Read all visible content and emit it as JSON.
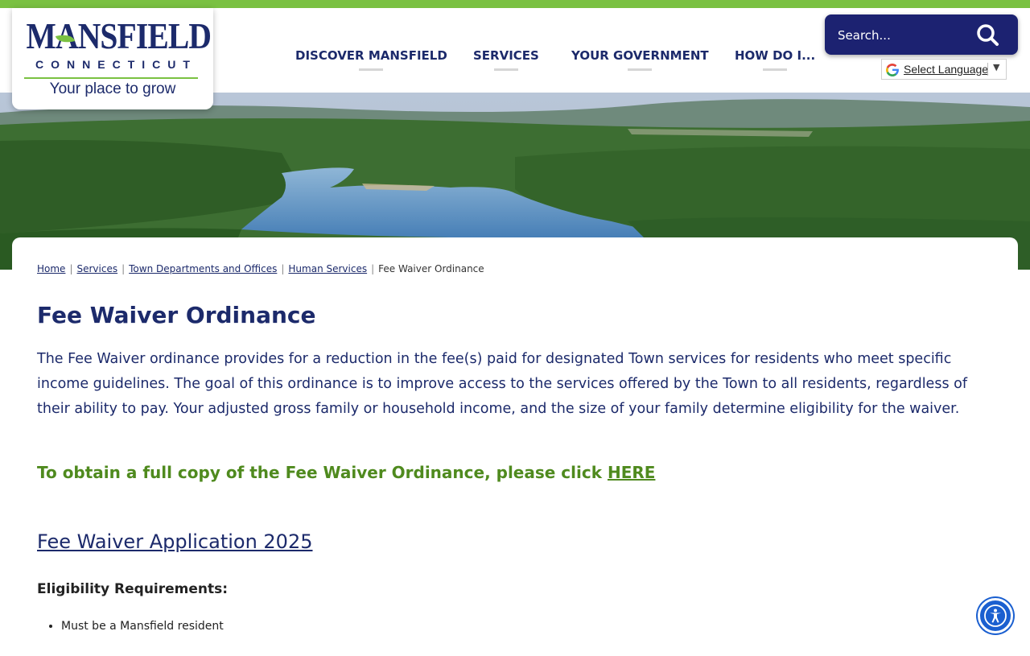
{
  "site": {
    "logo": {
      "name": "MANSFIELD",
      "sub": "CONNECTICUT",
      "tagline": "Your place to grow"
    }
  },
  "nav": {
    "items": [
      {
        "label": "DISCOVER MANSFIELD"
      },
      {
        "label": "SERVICES"
      },
      {
        "label": "YOUR GOVERNMENT"
      },
      {
        "label": "HOW DO I..."
      }
    ]
  },
  "search": {
    "placeholder": "Search..."
  },
  "language": {
    "label": "Select Language",
    "arrow": "▼"
  },
  "breadcrumb": {
    "items": [
      {
        "label": "Home"
      },
      {
        "label": "Services"
      },
      {
        "label": "Town Departments and Offices"
      },
      {
        "label": "Human Services"
      }
    ],
    "current": "Fee Waiver Ordinance",
    "separator": "|"
  },
  "page": {
    "title": "Fee Waiver Ordinance",
    "intro": "The Fee Waiver ordinance provides for a reduction in the fee(s) paid for designated Town services for residents who meet specific income guidelines. The goal of this ordinance is to improve access to the services offered by the Town to all residents, regardless of their ability to pay. Your adjusted gross family or household income, and the size of your family determine eligibility for the waiver.",
    "obtain_text": "To obtain a full copy of the Fee Waiver Ordinance, please click ",
    "obtain_link": "HERE",
    "application_link": "Fee Waiver Application 2025",
    "eligibility_heading": "Eligibility Requirements:",
    "requirements": [
      "Must be a Mansfield resident"
    ]
  },
  "colors": {
    "navy": "#1c2a6b",
    "green": "#7ac142",
    "search_bg": "#1c2271",
    "obtain_green": "#4f8a1e",
    "accessibility_blue": "#1a5fd0"
  }
}
